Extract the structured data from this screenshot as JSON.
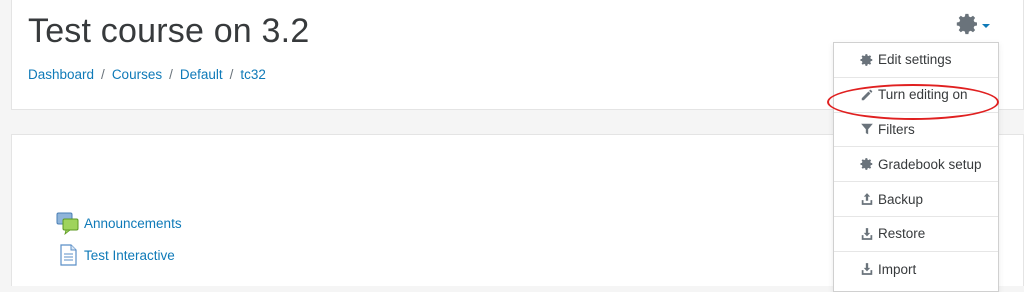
{
  "page": {
    "title": "Test course on 3.2"
  },
  "breadcrumb": {
    "items": [
      {
        "label": "Dashboard"
      },
      {
        "label": "Courses"
      },
      {
        "label": "Default"
      },
      {
        "label": "tc32"
      }
    ],
    "separator": "/"
  },
  "actions_menu": {
    "trigger_icon": "gear-icon",
    "items": [
      {
        "label": "Edit settings",
        "icon": "gear-icon"
      },
      {
        "label": "Turn editing on",
        "icon": "pencil-icon",
        "highlighted": true
      },
      {
        "label": "Filters",
        "icon": "filter-icon"
      },
      {
        "label": "Gradebook setup",
        "icon": "gear-icon"
      },
      {
        "label": "Backup",
        "icon": "upload-icon"
      },
      {
        "label": "Restore",
        "icon": "download-icon"
      },
      {
        "label": "Import",
        "icon": "download-icon"
      }
    ]
  },
  "activities": [
    {
      "label": "Announcements",
      "icon": "forum-icon"
    },
    {
      "label": "Test Interactive",
      "icon": "page-icon"
    }
  ],
  "colors": {
    "link": "#0f7ab8",
    "highlight": "#e02020",
    "icon_gray": "#6a737b"
  }
}
